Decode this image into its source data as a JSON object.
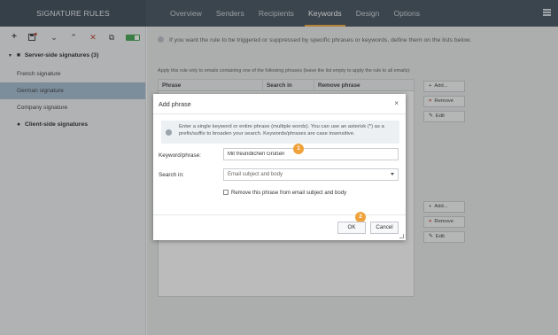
{
  "app": {
    "title": "SIGNATURE RULES"
  },
  "tabs": [
    {
      "label": "Overview"
    },
    {
      "label": "Senders"
    },
    {
      "label": "Recipients"
    },
    {
      "label": "Keywords",
      "active": true
    },
    {
      "label": "Design"
    },
    {
      "label": "Options"
    }
  ],
  "sidebar": {
    "toolbar": [
      "+",
      "▪",
      "⌄",
      "⌃",
      "✕",
      "⧉"
    ],
    "groups": [
      {
        "label": "Server-side signatures (3)"
      },
      {
        "label": "Client-side signatures"
      }
    ],
    "items": [
      {
        "label": "French signature"
      },
      {
        "label": "German signature",
        "selected": true
      },
      {
        "label": "Company signature"
      }
    ]
  },
  "main": {
    "info": "If you want the rule to be triggered or suppressed by specific phrases or keywords, define them on the lists below.",
    "note": "Apply this rule only to emails containing one of the following phrases (leave the list empty to apply the rule to all emails):",
    "grid_headers": [
      "Phrase",
      "Search in",
      "Remove phrase"
    ],
    "buttons_top": {
      "add": "Add...",
      "remove": "Remove",
      "edit": "Edit"
    },
    "buttons_bottom": {
      "add": "Add...",
      "remove": "Remove",
      "edit": "Edit"
    }
  },
  "dialog": {
    "title": "Add phrase",
    "info": "Enter a single keyword or entire phrase (multiple words). You can use an asterisk (*) as a prefix/suffix to broaden your search. Keywords/phrases are case insensitive.",
    "keyword_label": "Keyword/phrase:",
    "keyword_value": "Mit freundlichen Grüßen",
    "search_label": "Search in:",
    "search_value": "Email subject and body",
    "checkbox_label": "Remove this phrase from email subject and body",
    "ok": "OK",
    "cancel": "Cancel",
    "step1": "1",
    "step2": "2"
  },
  "colors": {
    "accent": "#f3a63a",
    "topbar": "#3b4a57",
    "selected": "#9fb9d0"
  }
}
